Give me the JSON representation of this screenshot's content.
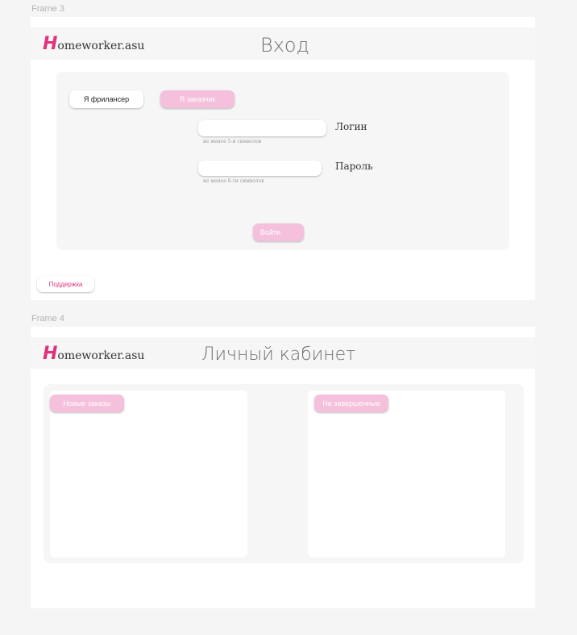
{
  "frame3": {
    "label": "Frame 3",
    "logo": {
      "mark": "H",
      "text": "omeworker.asu"
    },
    "title": "Вход",
    "tabs": {
      "freelancer": "Я фрилансер",
      "customer": "Я заказчик"
    },
    "login": {
      "label": "Логин",
      "value": "",
      "hint": "не менее 5-и символов"
    },
    "password": {
      "label": "Пароль",
      "value": "",
      "hint": "не менее 6-ти символов"
    },
    "submit": "Войти",
    "support": "Поддержка"
  },
  "frame4": {
    "label": "Frame 4",
    "logo": {
      "mark": "H",
      "text": "omeworker.asu"
    },
    "title": "Личный кабинет",
    "new_orders": "Новые заказы",
    "unfinished": "Не завершенные"
  },
  "colors": {
    "brand": "#e0337d",
    "accent_pink": "#f5c0dc",
    "panel_bg": "#f6f6f6",
    "page_bg": "#f5f5f5"
  }
}
